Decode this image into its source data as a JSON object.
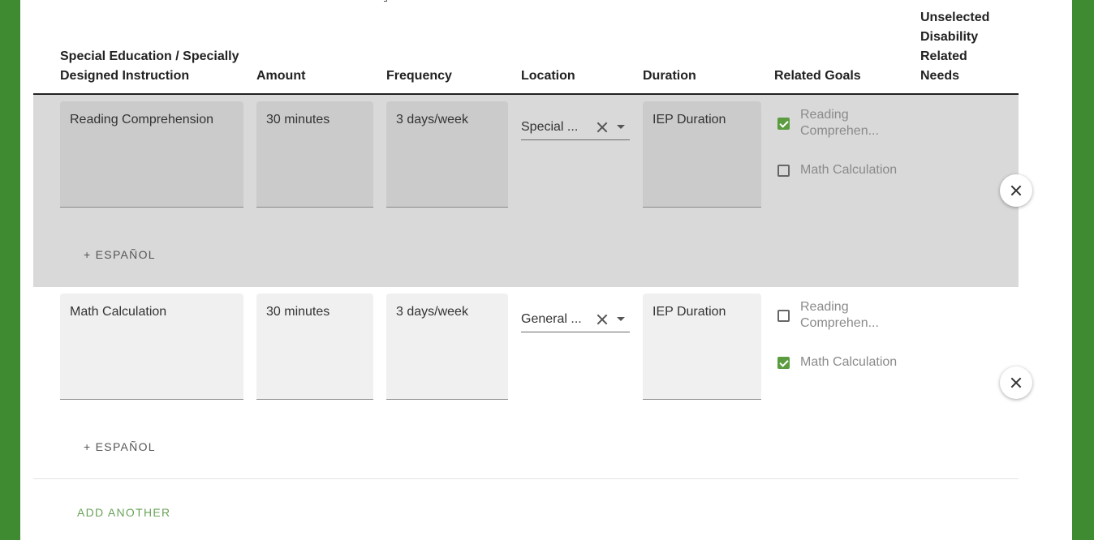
{
  "headers": {
    "instruction": "Special Education / Specially Designed Instruction",
    "amount": "Amount",
    "frequency": "Frequency",
    "location": "Location",
    "duration": "Duration",
    "related_goals": "Related Goals",
    "unselected": "Unselected Disability Related Needs"
  },
  "rows": [
    {
      "instruction": "Reading Comprehension",
      "amount": "30 minutes",
      "frequency": "3 days/week",
      "location": "Special ...",
      "duration": "IEP Duration",
      "goals": [
        {
          "label": "Reading Comprehen...",
          "checked": true
        },
        {
          "label": "Math Calculation",
          "checked": false
        }
      ],
      "espanol": "+ ESPAÑOL"
    },
    {
      "instruction": "Math Calculation",
      "amount": "30 minutes",
      "frequency": "3 days/week",
      "location": "General ...",
      "duration": "IEP Duration",
      "goals": [
        {
          "label": "Reading Comprehen...",
          "checked": false
        },
        {
          "label": "Math Calculation",
          "checked": true
        }
      ],
      "espanol": "+ ESPAÑOL"
    }
  ],
  "add_another": "ADD ANOTHER",
  "colors": {
    "accent": "#5a9c3f",
    "frame": "#3f8b32",
    "selected_row": "#d9d9d9"
  },
  "icons": [
    "close-icon",
    "clear-icon",
    "dropdown-caret-icon",
    "checkbox-icon"
  ]
}
